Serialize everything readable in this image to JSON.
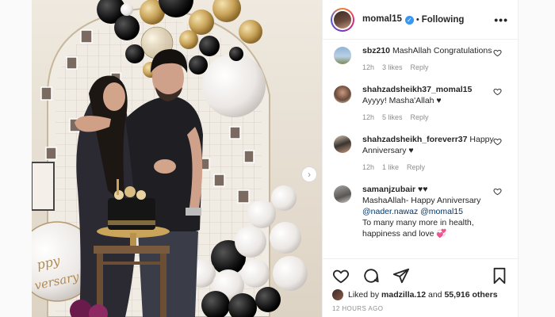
{
  "post": {
    "username": "momal15",
    "following_label": "Following",
    "separator": "•"
  },
  "comments": [
    {
      "user": "sbz210",
      "text": "MashAllah Congratulations",
      "time": "12h",
      "likes": "3 likes",
      "reply": "Reply"
    },
    {
      "user": "shahzadsheikh37_momal15",
      "text": "Ayyyy! Masha'Allah ♥",
      "time": "12h",
      "likes": "5 likes",
      "reply": "Reply"
    },
    {
      "user": "shahzadsheikh_foreverr37",
      "text": "Happy Anniversary ♥",
      "time": "12h",
      "likes": "1 like",
      "reply": "Reply"
    },
    {
      "user": "samanjzubair",
      "text_pre": "♥♥",
      "line2": "MashaAllah- Happy Anniversary",
      "mention1": "@nader.nawaz",
      "mention2": "@momal15",
      "line3": "To many many more in health, happiness and love 💞"
    }
  ],
  "likes": {
    "prefix": "Liked by",
    "user": "madzilla.12",
    "and": "and",
    "count": "55,916 others"
  },
  "timestamp": "12 HOURS AGO",
  "colors": {
    "accent_blue": "#3897f0",
    "mention": "#00376b",
    "meta_gray": "#8e8e8e"
  },
  "icons": [
    "heart-icon",
    "comment-icon",
    "share-icon",
    "bookmark-icon",
    "more-options-icon",
    "verified-badge-icon",
    "next-arrow-icon"
  ]
}
